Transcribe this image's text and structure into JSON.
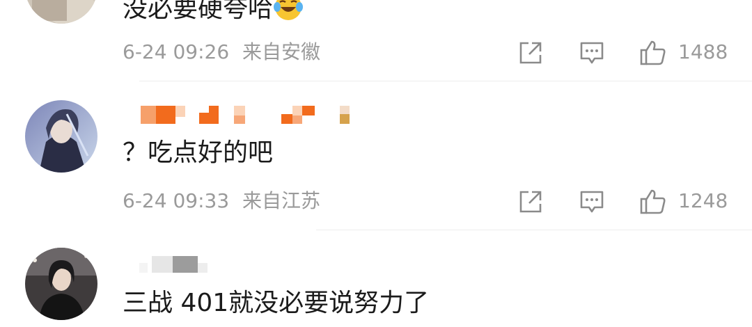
{
  "comments": [
    {
      "text": "没必要硬夸哈",
      "time": "6-24 09:26",
      "location": "来自安徽",
      "likes": "1488"
    },
    {
      "text": "？吃点好的吧",
      "time": "6-24 09:33",
      "location": "来自江苏",
      "likes": "1248"
    },
    {
      "text": "三战 401就没必要说努力了"
    }
  ],
  "icons": {
    "share": "share-icon",
    "comment": "comment-icon",
    "like": "like-icon",
    "emoji": "laughing-crying-emoji"
  },
  "colors": {
    "meta_text": "#9a9a9a",
    "body_text": "#1b1b1b",
    "divider": "#ececec",
    "masked_name": "#f26b1d"
  }
}
